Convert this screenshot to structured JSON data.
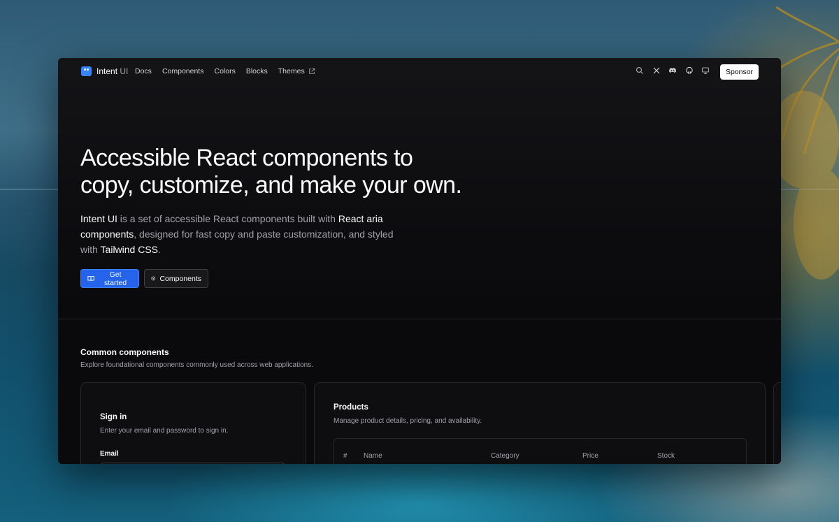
{
  "nav": {
    "brand": "Intent",
    "brand_suffix": "UI",
    "links": [
      "Docs",
      "Components",
      "Colors",
      "Blocks",
      "Themes"
    ],
    "icons": [
      "search-icon",
      "x-icon",
      "discord-icon",
      "github-icon",
      "monitor-icon"
    ],
    "sponsor_label": "Sponsor"
  },
  "hero": {
    "title_line1": "Accessible React components to",
    "title_line2": "copy, customize, and make your own.",
    "desc_part1": "Intent UI",
    "desc_part2": " is a set of accessible React components built with ",
    "desc_part3": "React aria components",
    "desc_part4": ", designed for fast copy and paste customization, and styled with ",
    "desc_part5": "Tailwind CSS",
    "desc_part6": ".",
    "get_started_label": "Get started",
    "components_label": "Components"
  },
  "common": {
    "title": "Common components",
    "subtitle": "Explore foundational components commonly used across web applications."
  },
  "signin": {
    "title": "Sign in",
    "subtitle": "Enter your email and password to sign in.",
    "email_label": "Email"
  },
  "products": {
    "title": "Products",
    "subtitle": "Manage product details, pricing, and availability.",
    "columns": [
      "#",
      "Name",
      "Category",
      "Price",
      "Stock"
    ]
  },
  "colors": {
    "accent": "#2563eb",
    "window_bg": "#0a0a0c",
    "muted_text": "#a1a1aa"
  }
}
